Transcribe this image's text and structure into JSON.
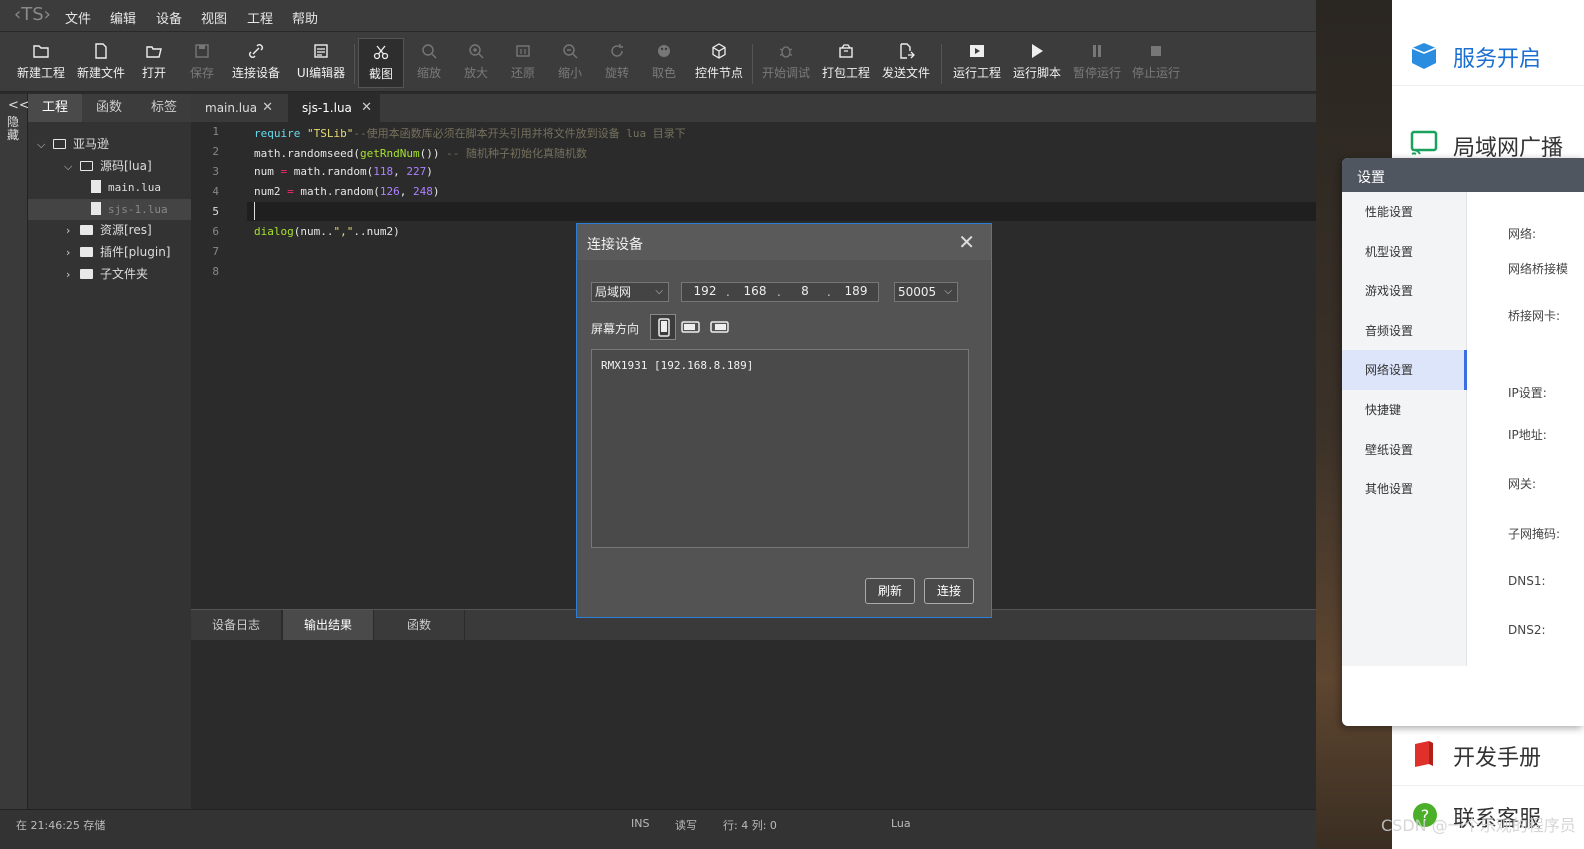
{
  "menubar": {
    "logo": "‹TS›",
    "items": [
      "文件",
      "编辑",
      "设备",
      "视图",
      "工程",
      "帮助"
    ]
  },
  "toolbar": {
    "tools": [
      {
        "label": "新建工程",
        "icon": "new-project-icon",
        "enabled": true
      },
      {
        "label": "新建文件",
        "icon": "new-file-icon",
        "enabled": true
      },
      {
        "label": "打开",
        "icon": "open-icon",
        "enabled": true
      },
      {
        "label": "保存",
        "icon": "save-icon",
        "enabled": false
      },
      {
        "label": "连接设备",
        "icon": "link-icon",
        "enabled": true
      },
      {
        "label": "UI编辑器",
        "icon": "ui-editor-icon",
        "enabled": true
      },
      {
        "label": "截图",
        "icon": "scissors-icon",
        "enabled": true,
        "active": true
      },
      {
        "label": "缩放",
        "icon": "zoom-icon",
        "enabled": false
      },
      {
        "label": "放大",
        "icon": "zoom-in-icon",
        "enabled": false
      },
      {
        "label": "还原",
        "icon": "restore-icon",
        "enabled": false
      },
      {
        "label": "缩小",
        "icon": "zoom-out-icon",
        "enabled": false
      },
      {
        "label": "旋转",
        "icon": "rotate-icon",
        "enabled": false
      },
      {
        "label": "取色",
        "icon": "palette-icon",
        "enabled": false
      },
      {
        "label": "控件节点",
        "icon": "cube-icon",
        "enabled": true
      },
      {
        "label": "开始调试",
        "icon": "bug-icon",
        "enabled": false
      },
      {
        "label": "打包工程",
        "icon": "package-icon",
        "enabled": true
      },
      {
        "label": "发送文件",
        "icon": "send-file-icon",
        "enabled": true
      },
      {
        "label": "运行工程",
        "icon": "run-project-icon",
        "enabled": true
      },
      {
        "label": "运行脚本",
        "icon": "play-icon",
        "enabled": true
      },
      {
        "label": "暂停运行",
        "icon": "pause-icon",
        "enabled": false
      },
      {
        "label": "停止运行",
        "icon": "stop-icon",
        "enabled": false
      }
    ]
  },
  "hide_strip": {
    "arrow": "<<",
    "label": "隐藏"
  },
  "sidebar": {
    "tabs": [
      "工程",
      "函数",
      "标签"
    ],
    "tree": [
      {
        "label": "亚马逊",
        "type": "folder-open"
      },
      {
        "label": "源码[lua]",
        "type": "folder-open"
      },
      {
        "label": "main.lua",
        "type": "file"
      },
      {
        "label": "sjs-1.lua",
        "type": "file",
        "selected": true
      },
      {
        "label": "资源[res]",
        "type": "folder"
      },
      {
        "label": "插件[plugin]",
        "type": "folder"
      },
      {
        "label": "子文件夹",
        "type": "folder"
      }
    ]
  },
  "editor_tabs": [
    {
      "label": "main.lua",
      "close": "✕"
    },
    {
      "label": "sjs-1.lua",
      "close": "✕",
      "active": true
    }
  ],
  "code": {
    "line_numbers": [
      "1",
      "2",
      "3",
      "4",
      "5",
      "6",
      "7",
      "8"
    ],
    "l1": {
      "a": "require ",
      "b": "\"TSLib\"",
      "c": "--使用本函数库必须在脚本开头引用并将文件放到设备 lua 目录下"
    },
    "l2": {
      "a": "math.randomseed(",
      "b": "getRndNum",
      "c": "()) ",
      "d": "-- 随机种子初始化真随机数"
    },
    "l3": {
      "a": "num ",
      "b": "=",
      "c": " math.random(",
      "d": "118",
      "e": ", ",
      "f": "227",
      "g": ")"
    },
    "l4": {
      "a": "num2 ",
      "b": "=",
      "c": " math.random(",
      "d": "126",
      "e": ", ",
      "f": "248",
      "g": ")"
    },
    "l6": {
      "a": "dialog",
      "b": "(num..",
      "c": "\",\"",
      "d": "..num2)"
    }
  },
  "bottom_tabs": [
    "设备日志",
    "输出结果",
    "函数"
  ],
  "statusbar": {
    "saved": "在 21:46:25 存储",
    "ins": "INS",
    "rw": "读写",
    "pos": "行: 4 列: 0",
    "lang": "Lua"
  },
  "dialog": {
    "title": "连接设备",
    "close": "✕",
    "mode": "局域网",
    "ip": [
      "192",
      "168",
      "8",
      "189"
    ],
    "port": "50005",
    "orientation_label": "屏幕方向",
    "devices": [
      "RMX1931 [192.168.8.189]"
    ],
    "refresh": "刷新",
    "connect": "连接"
  },
  "right_panel": {
    "items": [
      "服务开启",
      "局域网广播",
      "开发手册",
      "联系客服"
    ]
  },
  "settings": {
    "title": "设置",
    "nav": [
      "性能设置",
      "机型设置",
      "游戏设置",
      "音频设置",
      "网络设置",
      "快捷键",
      "壁纸设置",
      "其他设置"
    ],
    "active_nav": "网络设置",
    "fields": [
      "网络:",
      "网络桥接模",
      "桥接网卡:",
      "IP设置:",
      "IP地址:",
      "网关:",
      "子网掩码:",
      "DNS1:",
      "DNS2:"
    ]
  },
  "watermark": "CSDN @一个乐观的程序员"
}
